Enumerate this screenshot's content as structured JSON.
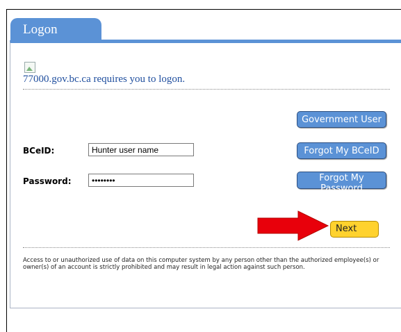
{
  "tab": {
    "label": "Logon"
  },
  "heading": "77000.gov.bc.ca requires you to logon.",
  "form": {
    "bceid_label": "BCeID:",
    "bceid_value": "Hunter user name",
    "password_label": "Password:",
    "password_value": "••••••••"
  },
  "buttons": {
    "government_user": "Government User",
    "forgot_bceid": "Forgot My BCeID",
    "forgot_password": "Forgot My Password",
    "next": "Next"
  },
  "notice": "Access to or unauthorized use of data on this computer system by any person other than the authorized employee(s) or owner(s) of an account is strictly prohibited and may result in legal action against such person.",
  "colors": {
    "accent": "#5b92d6",
    "next": "#ffd22e",
    "arrow": "#e8000b",
    "heading": "#1f4e9e"
  },
  "icons": {
    "arrow": "red-arrow-icon",
    "broken_image": "broken-image-icon"
  }
}
